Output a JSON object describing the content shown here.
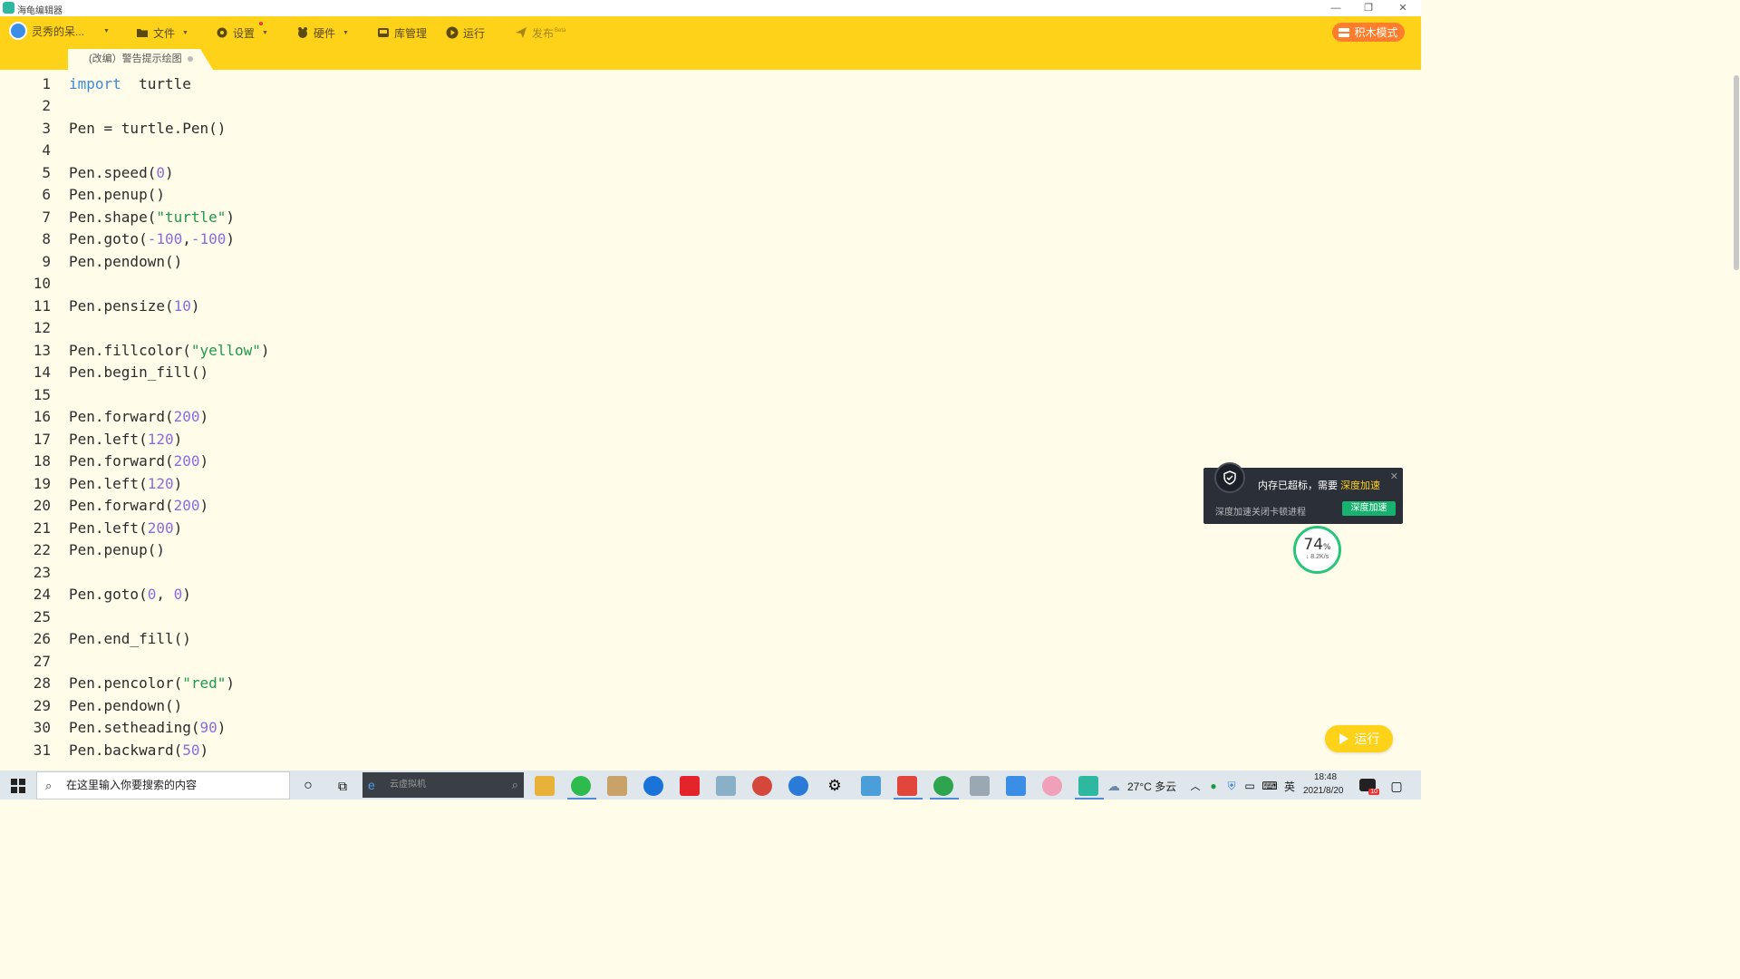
{
  "window": {
    "title": "海龟编辑器",
    "controls": [
      "—",
      "❐",
      "✕"
    ]
  },
  "toolbar": {
    "user_label": "灵秀的呆...",
    "file": "文件",
    "settings": "设置",
    "hardware": "硬件",
    "library": "库管理",
    "run": "运行",
    "publish": "发布",
    "publish_badge": "Beta",
    "block_mode": "积木模式"
  },
  "tab": {
    "title": "(改编）警告提示绘图"
  },
  "editor": {
    "lines": [
      {
        "n": "1",
        "tokens": [
          [
            "kw",
            "import"
          ],
          [
            "",
            "  turtle"
          ]
        ]
      },
      {
        "n": "2",
        "tokens": []
      },
      {
        "n": "3",
        "tokens": [
          [
            "",
            "Pen = turtle.Pen()"
          ]
        ]
      },
      {
        "n": "4",
        "tokens": []
      },
      {
        "n": "5",
        "tokens": [
          [
            "",
            "Pen.speed("
          ],
          [
            "num",
            "0"
          ],
          [
            "",
            ")"
          ]
        ]
      },
      {
        "n": "6",
        "tokens": [
          [
            "",
            "Pen.penup()"
          ]
        ]
      },
      {
        "n": "7",
        "tokens": [
          [
            "",
            "Pen.shape("
          ],
          [
            "str",
            "\"turtle\""
          ],
          [
            "",
            ")"
          ]
        ]
      },
      {
        "n": "8",
        "tokens": [
          [
            "",
            "Pen.goto("
          ],
          [
            "num",
            "-100"
          ],
          [
            "",
            ","
          ],
          [
            "num",
            "-100"
          ],
          [
            "",
            ")"
          ]
        ]
      },
      {
        "n": "9",
        "tokens": [
          [
            "",
            "Pen.pendown()"
          ]
        ]
      },
      {
        "n": "10",
        "tokens": []
      },
      {
        "n": "11",
        "tokens": [
          [
            "",
            "Pen.pensize("
          ],
          [
            "num",
            "10"
          ],
          [
            "",
            ")"
          ]
        ]
      },
      {
        "n": "12",
        "tokens": []
      },
      {
        "n": "13",
        "tokens": [
          [
            "",
            "Pen.fillcolor("
          ],
          [
            "str",
            "\"yellow\""
          ],
          [
            "",
            ")"
          ]
        ]
      },
      {
        "n": "14",
        "tokens": [
          [
            "",
            "Pen.begin_fill()"
          ]
        ]
      },
      {
        "n": "15",
        "tokens": []
      },
      {
        "n": "16",
        "tokens": [
          [
            "",
            "Pen.forward("
          ],
          [
            "num",
            "200"
          ],
          [
            "",
            ")"
          ]
        ]
      },
      {
        "n": "17",
        "tokens": [
          [
            "",
            "Pen.left("
          ],
          [
            "num",
            "120"
          ],
          [
            "",
            ")"
          ]
        ]
      },
      {
        "n": "18",
        "tokens": [
          [
            "",
            "Pen.forward("
          ],
          [
            "num",
            "200"
          ],
          [
            "",
            ")"
          ]
        ]
      },
      {
        "n": "19",
        "tokens": [
          [
            "",
            "Pen.left("
          ],
          [
            "num",
            "120"
          ],
          [
            "",
            ")"
          ]
        ]
      },
      {
        "n": "20",
        "tokens": [
          [
            "",
            "Pen.forward("
          ],
          [
            "num",
            "200"
          ],
          [
            "",
            ")"
          ]
        ]
      },
      {
        "n": "21",
        "tokens": [
          [
            "",
            "Pen.left("
          ],
          [
            "num",
            "200"
          ],
          [
            "",
            ")"
          ]
        ]
      },
      {
        "n": "22",
        "tokens": [
          [
            "",
            "Pen.penup()"
          ]
        ]
      },
      {
        "n": "23",
        "tokens": []
      },
      {
        "n": "24",
        "tokens": [
          [
            "",
            "Pen.goto("
          ],
          [
            "num",
            "0"
          ],
          [
            "",
            ", "
          ],
          [
            "num",
            "0"
          ],
          [
            "",
            ")"
          ]
        ]
      },
      {
        "n": "25",
        "tokens": []
      },
      {
        "n": "26",
        "tokens": [
          [
            "",
            "Pen.end_fill()"
          ]
        ]
      },
      {
        "n": "27",
        "tokens": []
      },
      {
        "n": "28",
        "tokens": [
          [
            "",
            "Pen.pencolor("
          ],
          [
            "str",
            "\"red\""
          ],
          [
            "",
            ")"
          ]
        ]
      },
      {
        "n": "29",
        "tokens": [
          [
            "",
            "Pen.pendown()"
          ]
        ]
      },
      {
        "n": "30",
        "tokens": [
          [
            "",
            "Pen.setheading("
          ],
          [
            "num",
            "90"
          ],
          [
            "",
            ")"
          ]
        ]
      },
      {
        "n": "31",
        "tokens": [
          [
            "",
            "Pen.backward("
          ],
          [
            "num",
            "50"
          ],
          [
            "",
            ")"
          ]
        ]
      }
    ]
  },
  "popup": {
    "message": "内存已超标，需要",
    "highlight": "深度加速",
    "sub": "深度加速关闭卡顿进程",
    "button": "深度加速",
    "close": "✕"
  },
  "memory_widget": {
    "percent": "74",
    "percent_sign": "%",
    "speed": "↓ 8.2K/s"
  },
  "run_button": {
    "label": "运行"
  },
  "taskbar": {
    "search_placeholder": "在这里输入你要搜索的内容",
    "browser_search": "云虚拟机",
    "weather": "27°C 多云",
    "ime": "英",
    "time": "18:48",
    "date": "2021/8/20",
    "notification_count": "10"
  }
}
